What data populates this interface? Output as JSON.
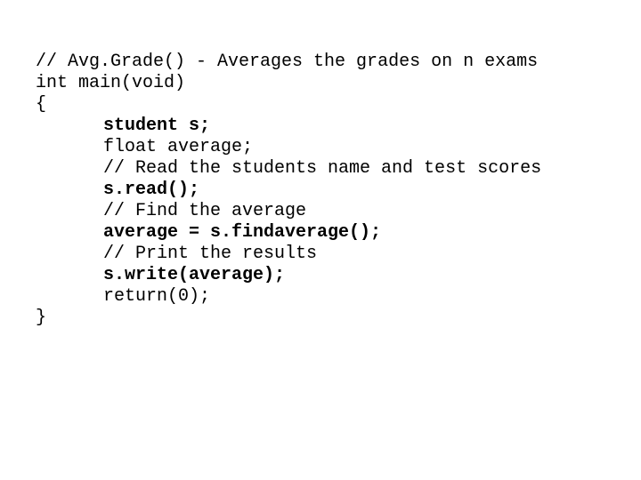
{
  "slide": {
    "background_color": "#ffffff",
    "text_color": "#000000"
  },
  "code": {
    "language": "cpp",
    "lines": [
      {
        "text": "// Avg.Grade() - Averages the grades on n exams",
        "bold": false,
        "indent": false
      },
      {
        "text": "int main(void)",
        "bold": false,
        "indent": false
      },
      {
        "text": "{",
        "bold": false,
        "indent": false
      },
      {
        "text": "student s;",
        "bold": true,
        "indent": true
      },
      {
        "text": "float average;",
        "bold": false,
        "indent": true
      },
      {
        "text": "// Read the students name and test scores",
        "bold": false,
        "indent": true
      },
      {
        "text": "s.read();",
        "bold": true,
        "indent": true
      },
      {
        "text": "// Find the average",
        "bold": false,
        "indent": true
      },
      {
        "text": "average = s.findaverage();",
        "bold": true,
        "indent": true
      },
      {
        "text": "// Print the results",
        "bold": false,
        "indent": true
      },
      {
        "text": "s.write(average);",
        "bold": true,
        "indent": true
      },
      {
        "text": "return(0);",
        "bold": false,
        "indent": true
      },
      {
        "text": "}",
        "bold": false,
        "indent": false
      }
    ]
  }
}
